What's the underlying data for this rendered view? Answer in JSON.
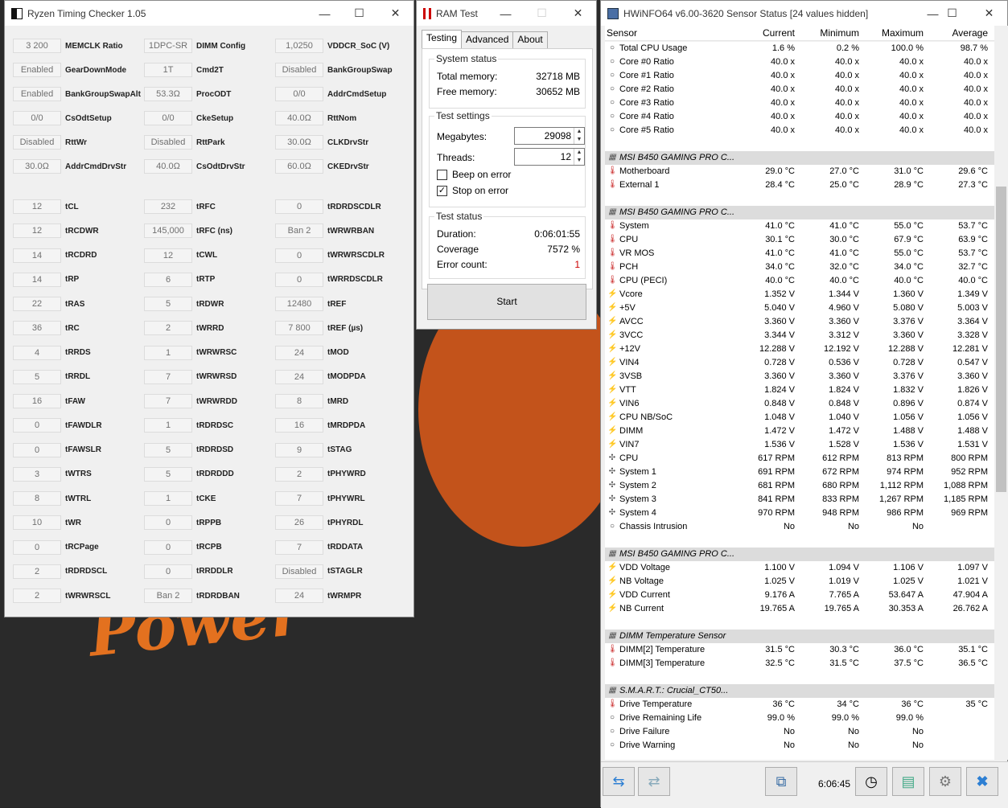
{
  "rtc": {
    "title": "Ryzen Timing Checker 1.05",
    "cols": [
      [
        [
          "3 200",
          "MEMCLK Ratio"
        ],
        [
          "Enabled",
          "GearDownMode"
        ],
        [
          "Enabled",
          "BankGroupSwapAlt"
        ],
        [
          "0/0",
          "CsOdtSetup"
        ],
        [
          "Disabled",
          "RttWr"
        ],
        [
          "30.0Ω",
          "AddrCmdDrvStr"
        ],
        [
          "12",
          "tCL"
        ],
        [
          "12",
          "tRCDWR"
        ],
        [
          "14",
          "tRCDRD"
        ],
        [
          "14",
          "tRP"
        ],
        [
          "22",
          "tRAS"
        ],
        [
          "36",
          "tRC"
        ],
        [
          "4",
          "tRRDS"
        ],
        [
          "5",
          "tRRDL"
        ],
        [
          "16",
          "tFAW"
        ],
        [
          "0",
          "tFAWDLR"
        ],
        [
          "0",
          "tFAWSLR"
        ],
        [
          "3",
          "tWTRS"
        ],
        [
          "8",
          "tWTRL"
        ],
        [
          "10",
          "tWR"
        ],
        [
          "0",
          "tRCPage"
        ],
        [
          "2",
          "tRDRDSCL"
        ],
        [
          "2",
          "tWRWRSCL"
        ]
      ],
      [
        [
          "1DPC-SR",
          "DIMM Config"
        ],
        [
          "1T",
          "Cmd2T"
        ],
        [
          "53.3Ω",
          "ProcODT"
        ],
        [
          "0/0",
          "CkeSetup"
        ],
        [
          "Disabled",
          "RttPark"
        ],
        [
          "40.0Ω",
          "CsOdtDrvStr"
        ],
        [
          "232",
          "tRFC"
        ],
        [
          "145,000",
          "tRFC (ns)"
        ],
        [
          "12",
          "tCWL"
        ],
        [
          "6",
          "tRTP"
        ],
        [
          "5",
          "tRDWR"
        ],
        [
          "2",
          "tWRRD"
        ],
        [
          "1",
          "tWRWRSC"
        ],
        [
          "7",
          "tWRWRSD"
        ],
        [
          "7",
          "tWRWRDD"
        ],
        [
          "1",
          "tRDRDSC"
        ],
        [
          "5",
          "tRDRDSD"
        ],
        [
          "5",
          "tRDRDDD"
        ],
        [
          "1",
          "tCKE"
        ],
        [
          "0",
          "tRPPB"
        ],
        [
          "0",
          "tRCPB"
        ],
        [
          "0",
          "tRRDDLR"
        ],
        [
          "Ban 2",
          "tRDRDBAN"
        ]
      ],
      [
        [
          "1,0250",
          "VDDCR_SoC (V)"
        ],
        [
          "Disabled",
          "BankGroupSwap"
        ],
        [
          "0/0",
          "AddrCmdSetup"
        ],
        [
          "40.0Ω",
          "RttNom"
        ],
        [
          "30.0Ω",
          "CLKDrvStr"
        ],
        [
          "60.0Ω",
          "CKEDrvStr"
        ],
        [
          "0",
          "tRDRDSCDLR"
        ],
        [
          "Ban 2",
          "tWRWRBAN"
        ],
        [
          "0",
          "tWRWRSCDLR"
        ],
        [
          "0",
          "tWRRDSCDLR"
        ],
        [
          "12480",
          "tREF"
        ],
        [
          "7 800",
          "tREF (µs)"
        ],
        [
          "24",
          "tMOD"
        ],
        [
          "24",
          "tMODPDA"
        ],
        [
          "8",
          "tMRD"
        ],
        [
          "16",
          "tMRDPDA"
        ],
        [
          "9",
          "tSTAG"
        ],
        [
          "2",
          "tPHYWRD"
        ],
        [
          "7",
          "tPHYWRL"
        ],
        [
          "26",
          "tPHYRDL"
        ],
        [
          "7",
          "tRDDATA"
        ],
        [
          "Disabled",
          "tSTAGLR"
        ],
        [
          "24",
          "tWRMPR"
        ]
      ]
    ]
  },
  "ram": {
    "title": "RAM Test",
    "tabs": [
      "Testing",
      "Advanced",
      "About"
    ],
    "system_status": "System status",
    "total_label": "Total memory:",
    "total": "32718 MB",
    "free_label": "Free memory:",
    "free": "30652 MB",
    "test_settings": "Test settings",
    "mb_label": "Megabytes:",
    "mb": "29098",
    "thr_label": "Threads:",
    "thr": "12",
    "beep": "Beep on error",
    "stop": "Stop on error",
    "test_status": "Test status",
    "dur_label": "Duration:",
    "dur": "0:06:01:55",
    "cov_label": "Coverage",
    "cov": "7572 %",
    "err_label": "Error count:",
    "err": "1",
    "start": "Start"
  },
  "hw": {
    "title": "HWiNFO64 v6.00-3620 Sensor Status [24 values hidden]",
    "cols": [
      "Sensor",
      "Current",
      "Minimum",
      "Maximum",
      "Average"
    ],
    "time": "6:06:45",
    "rows": [
      [
        "c",
        "Total CPU Usage",
        "1.6 %",
        "0.2 %",
        "100.0 %",
        "98.7 %"
      ],
      [
        "c",
        "Core #0 Ratio",
        "40.0 x",
        "40.0 x",
        "40.0 x",
        "40.0 x"
      ],
      [
        "c",
        "Core #1 Ratio",
        "40.0 x",
        "40.0 x",
        "40.0 x",
        "40.0 x"
      ],
      [
        "c",
        "Core #2 Ratio",
        "40.0 x",
        "40.0 x",
        "40.0 x",
        "40.0 x"
      ],
      [
        "c",
        "Core #3 Ratio",
        "40.0 x",
        "40.0 x",
        "40.0 x",
        "40.0 x"
      ],
      [
        "c",
        "Core #4 Ratio",
        "40.0 x",
        "40.0 x",
        "40.0 x",
        "40.0 x"
      ],
      [
        "c",
        "Core #5 Ratio",
        "40.0 x",
        "40.0 x",
        "40.0 x",
        "40.0 x"
      ],
      [
        "e"
      ],
      [
        "s",
        "MSI B450 GAMING PRO C..."
      ],
      [
        "t",
        "Motherboard",
        "29.0 °C",
        "27.0 °C",
        "31.0 °C",
        "29.6 °C"
      ],
      [
        "t",
        "External 1",
        "28.4 °C",
        "25.0 °C",
        "28.9 °C",
        "27.3 °C"
      ],
      [
        "e"
      ],
      [
        "s",
        "MSI B450 GAMING PRO C..."
      ],
      [
        "t",
        "System",
        "41.0 °C",
        "41.0 °C",
        "55.0 °C",
        "53.7 °C"
      ],
      [
        "t",
        "CPU",
        "30.1 °C",
        "30.0 °C",
        "67.9 °C",
        "63.9 °C"
      ],
      [
        "t",
        "VR MOS",
        "41.0 °C",
        "41.0 °C",
        "55.0 °C",
        "53.7 °C"
      ],
      [
        "t",
        "PCH",
        "34.0 °C",
        "32.0 °C",
        "34.0 °C",
        "32.7 °C"
      ],
      [
        "t",
        "CPU (PECI)",
        "40.0 °C",
        "40.0 °C",
        "40.0 °C",
        "40.0 °C"
      ],
      [
        "v",
        "Vcore",
        "1.352 V",
        "1.344 V",
        "1.360 V",
        "1.349 V"
      ],
      [
        "v",
        "+5V",
        "5.040 V",
        "4.960 V",
        "5.080 V",
        "5.003 V"
      ],
      [
        "v",
        "AVCC",
        "3.360 V",
        "3.360 V",
        "3.376 V",
        "3.364 V"
      ],
      [
        "v",
        "3VCC",
        "3.344 V",
        "3.312 V",
        "3.360 V",
        "3.328 V"
      ],
      [
        "v",
        "+12V",
        "12.288 V",
        "12.192 V",
        "12.288 V",
        "12.281 V"
      ],
      [
        "v",
        "VIN4",
        "0.728 V",
        "0.536 V",
        "0.728 V",
        "0.547 V"
      ],
      [
        "v",
        "3VSB",
        "3.360 V",
        "3.360 V",
        "3.376 V",
        "3.360 V"
      ],
      [
        "v",
        "VTT",
        "1.824 V",
        "1.824 V",
        "1.832 V",
        "1.826 V"
      ],
      [
        "v",
        "VIN6",
        "0.848 V",
        "0.848 V",
        "0.896 V",
        "0.874 V"
      ],
      [
        "v",
        "CPU NB/SoC",
        "1.048 V",
        "1.040 V",
        "1.056 V",
        "1.056 V"
      ],
      [
        "v",
        "DIMM",
        "1.472 V",
        "1.472 V",
        "1.488 V",
        "1.488 V"
      ],
      [
        "v",
        "VIN7",
        "1.536 V",
        "1.528 V",
        "1.536 V",
        "1.531 V"
      ],
      [
        "f",
        "CPU",
        "617 RPM",
        "612 RPM",
        "813 RPM",
        "800 RPM"
      ],
      [
        "f",
        "System 1",
        "691 RPM",
        "672 RPM",
        "974 RPM",
        "952 RPM"
      ],
      [
        "f",
        "System 2",
        "681 RPM",
        "680 RPM",
        "1,112 RPM",
        "1,088 RPM"
      ],
      [
        "f",
        "System 3",
        "841 RPM",
        "833 RPM",
        "1,267 RPM",
        "1,185 RPM"
      ],
      [
        "f",
        "System 4",
        "970 RPM",
        "948 RPM",
        "986 RPM",
        "969 RPM"
      ],
      [
        "c",
        "Chassis Intrusion",
        "No",
        "No",
        "No",
        ""
      ],
      [
        "e"
      ],
      [
        "s",
        "MSI B450 GAMING PRO C..."
      ],
      [
        "v",
        "VDD Voltage",
        "1.100 V",
        "1.094 V",
        "1.106 V",
        "1.097 V"
      ],
      [
        "v",
        "NB Voltage",
        "1.025 V",
        "1.019 V",
        "1.025 V",
        "1.021 V"
      ],
      [
        "v",
        "VDD Current",
        "9.176 A",
        "7.765 A",
        "53.647 A",
        "47.904 A"
      ],
      [
        "v",
        "NB Current",
        "19.765 A",
        "19.765 A",
        "30.353 A",
        "26.762 A"
      ],
      [
        "e"
      ],
      [
        "s",
        "DIMM Temperature Sensor"
      ],
      [
        "t",
        "DIMM[2] Temperature",
        "31.5 °C",
        "30.3 °C",
        "36.0 °C",
        "35.1 °C"
      ],
      [
        "t",
        "DIMM[3] Temperature",
        "32.5 °C",
        "31.5 °C",
        "37.5 °C",
        "36.5 °C"
      ],
      [
        "e"
      ],
      [
        "s",
        "S.M.A.R.T.: Crucial_CT50..."
      ],
      [
        "t",
        "Drive Temperature",
        "36 °C",
        "34 °C",
        "36 °C",
        "35 °C"
      ],
      [
        "c",
        "Drive Remaining Life",
        "99.0 %",
        "99.0 %",
        "99.0 %",
        ""
      ],
      [
        "c",
        "Drive Failure",
        "No",
        "No",
        "No",
        ""
      ],
      [
        "c",
        "Drive Warning",
        "No",
        "No",
        "No",
        ""
      ]
    ]
  }
}
